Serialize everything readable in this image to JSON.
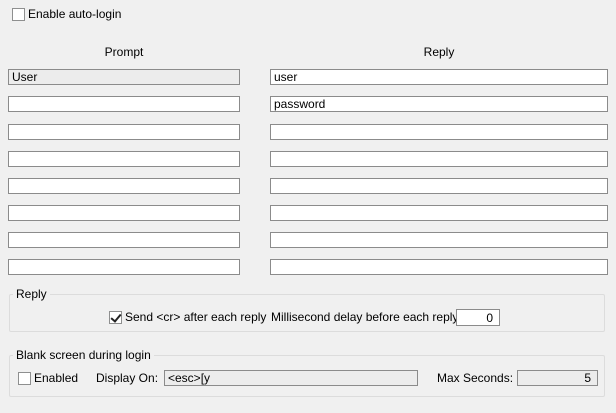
{
  "auto_login": {
    "label": "Enable auto-login",
    "checked": false
  },
  "columns": {
    "prompt": "Prompt",
    "reply": "Reply"
  },
  "rows": [
    {
      "prompt": "User",
      "reply": "user"
    },
    {
      "prompt": "",
      "reply": "password"
    },
    {
      "prompt": "",
      "reply": ""
    },
    {
      "prompt": "",
      "reply": ""
    },
    {
      "prompt": "",
      "reply": ""
    },
    {
      "prompt": "",
      "reply": ""
    },
    {
      "prompt": "",
      "reply": ""
    },
    {
      "prompt": "",
      "reply": ""
    }
  ],
  "reply_group": {
    "title": "Reply",
    "send_cr_label": "Send <cr> after each reply",
    "send_cr_checked": true,
    "delay_label": "Millisecond delay before each reply:",
    "delay_value": "0"
  },
  "blank_group": {
    "title": "Blank screen during login",
    "enabled_label": "Enabled",
    "enabled_checked": false,
    "display_on_label": "Display On:",
    "display_on_value": "<esc>[y",
    "max_seconds_label": "Max Seconds:",
    "max_seconds_value": "5"
  }
}
